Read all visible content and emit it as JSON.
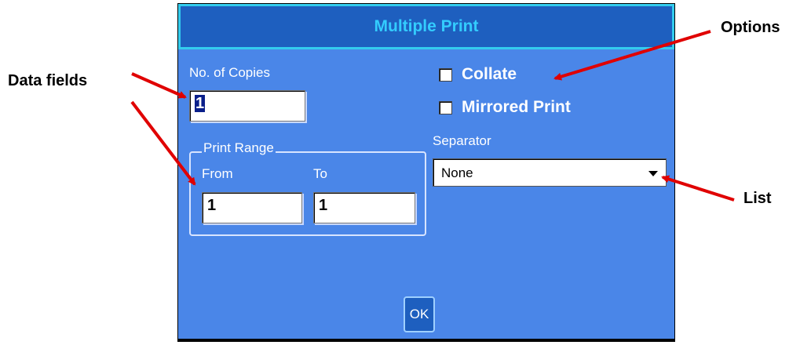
{
  "dialog": {
    "title": "Multiple Print",
    "copies_label": "No. of Copies",
    "copies_value": "1",
    "print_range_label": "Print Range",
    "from_label": "From",
    "to_label": "To",
    "from_value": "1",
    "to_value": "1",
    "collate_label": "Collate",
    "mirrored_label": "Mirrored Print",
    "separator_label": "Separator",
    "separator_value": "None",
    "ok_label": "OK"
  },
  "callouts": {
    "data_fields": "Data fields",
    "options": "Options",
    "list": "List"
  },
  "colors": {
    "dialog_bg": "#4a86e8",
    "title_text": "#33ccff",
    "arrow": "#e00000"
  }
}
